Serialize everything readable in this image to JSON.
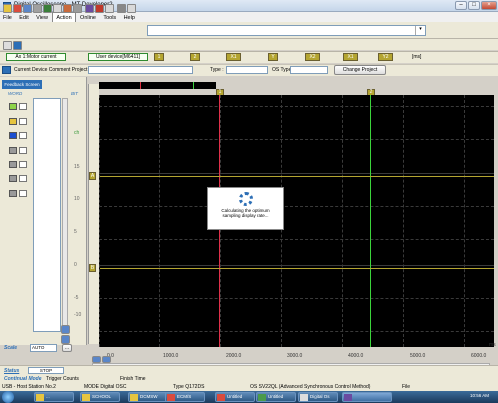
{
  "window": {
    "title": "Digital Oscilloscope - MT Developer2",
    "min_label": "–",
    "max_label": "□",
    "close_label": "×"
  },
  "menu": [
    "File",
    "Edit",
    "View",
    "Action",
    "Online",
    "Tools",
    "Help"
  ],
  "menu_active": "Action",
  "axis_field": "Ax 1:Motor current",
  "device_field": "User device[M6411]",
  "markers": [
    "1",
    "2",
    "X1",
    "Y",
    "X2",
    "X1",
    "Y2"
  ],
  "unit": "[ms]",
  "project": {
    "label": "Current Device Comment Project :",
    "type_label": "Type :",
    "os_label": "OS Type :",
    "change_btn": "Change Project"
  },
  "left_panel": {
    "feedback": "Feedback Screen",
    "word": "WORD",
    "bit": "BIT",
    "scale_labels": [
      "15",
      "10",
      "5",
      "0",
      "-5",
      "-10",
      "-15"
    ],
    "scale_prefix": "ch"
  },
  "plot": {
    "cursor_tags": [
      "1",
      "2"
    ],
    "channel_tags": [
      "A",
      "B"
    ],
    "x_ticks": [
      "0.0",
      "1000.0",
      "2000.0",
      "3000.0",
      "4000.0",
      "5000.0",
      "6000.0"
    ],
    "x_unit": "ms",
    "dialog_text1": "Calculating the optimum",
    "dialog_text2": "sampling display rate..."
  },
  "scale_ctrl": {
    "label": "Scale",
    "value": "AUTO"
  },
  "status": {
    "label": "Status",
    "state": "STOP",
    "cont_label": "Continual Mode",
    "trigger_label": "Trigger Counts",
    "finish_label": "Finish Time",
    "conn": "USB - Host Station No.2",
    "mode": "MODE   Digital OSC",
    "type": "Type   Q172DS",
    "os": "OS  SV22QL (Advanced Synchronous Control Method)",
    "file": "File"
  },
  "taskbar": {
    "items": [
      "...",
      "SCHOOL",
      "DCMSW",
      "ECM/S",
      "Untitled",
      "Untitled",
      "Digital Os"
    ],
    "clock": "10:56 AM"
  }
}
